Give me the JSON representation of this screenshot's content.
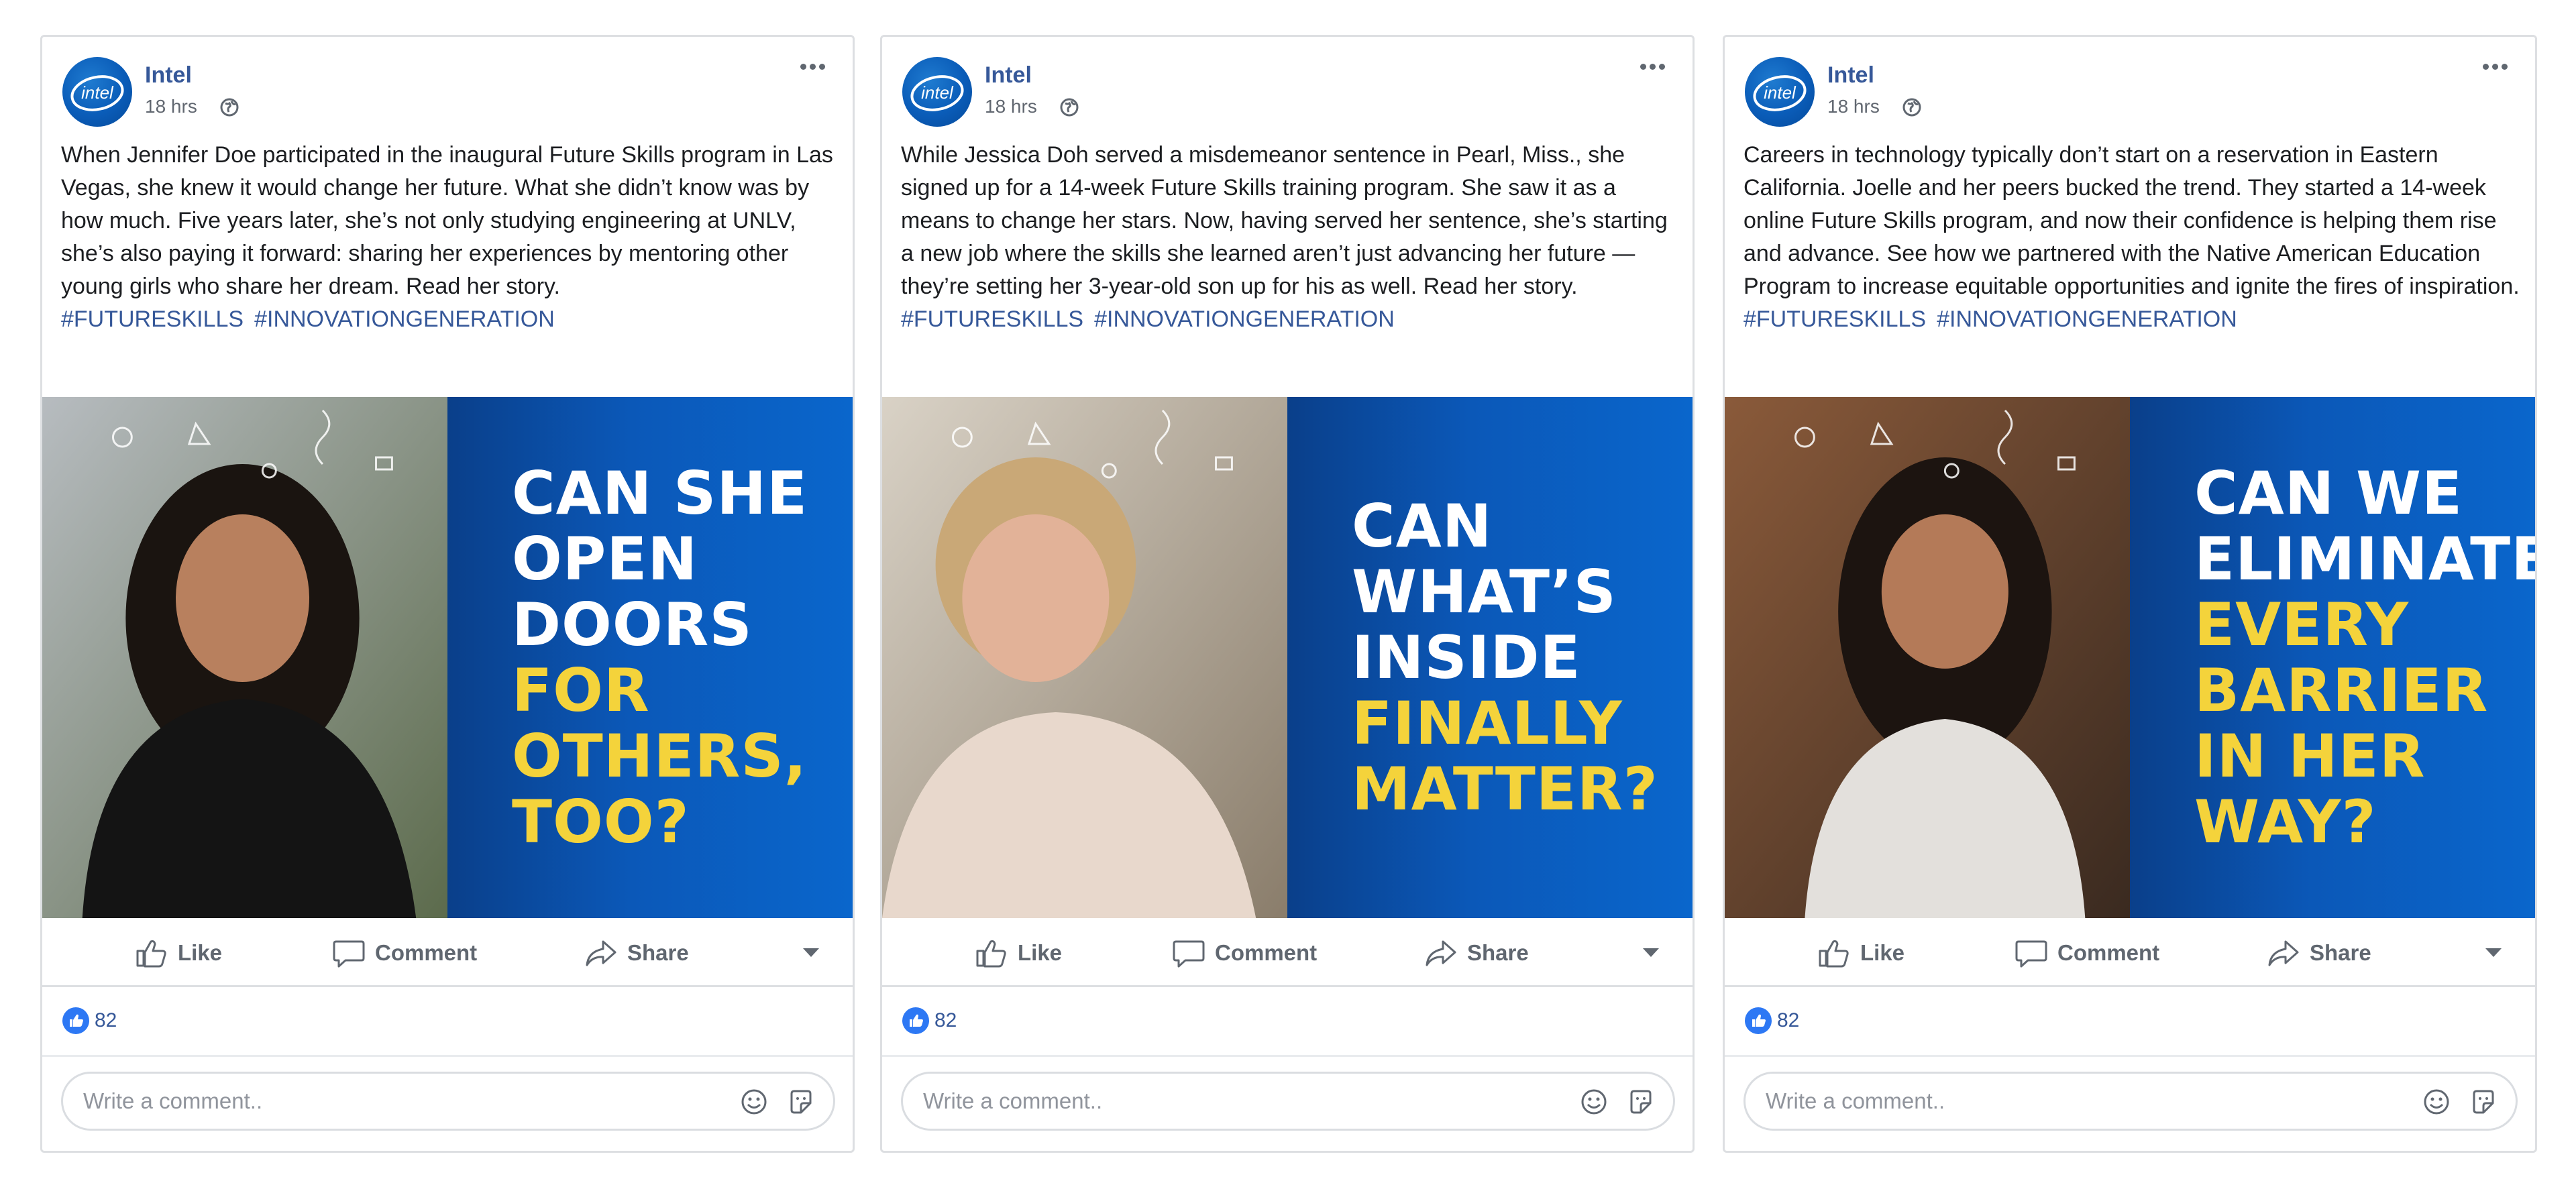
{
  "posts": [
    {
      "page_name": "Intel",
      "avatar_text": "intel",
      "timestamp": "18 hrs",
      "body": "When Jennifer Doe participated in the inaugural Future Skills program in Las Vegas, she knew it would change her future. What she didn’t know was by how much. Five years later, she’s not only studying engineering at UNLV, she’s also paying it forward: sharing her experiences by mentoring other young girls who share her dream. Read her story.",
      "hashtags": [
        "#FUTURESKILLS",
        "#INNOVATIONGENERATION"
      ],
      "headline": [
        {
          "text": "CAN SHE",
          "accent": false
        },
        {
          "text": "OPEN",
          "accent": false
        },
        {
          "text": "DOORS",
          "accent": false
        },
        {
          "text": "FOR",
          "accent": true
        },
        {
          "text": "OTHERS,",
          "accent": true
        },
        {
          "text": "TOO?",
          "accent": true
        }
      ],
      "actions": {
        "like": "Like",
        "comment": "Comment",
        "share": "Share"
      },
      "reaction_count": "82",
      "comment_placeholder": "Write a comment.."
    },
    {
      "page_name": "Intel",
      "avatar_text": "intel",
      "timestamp": "18 hrs",
      "body": "While Jessica Doh served a misdemeanor sentence in Pearl, Miss., she signed up for a 14-week Future Skills training program. She saw it as a means to change her stars. Now, having served her sentence, she’s starting a new job where the skills she learned aren’t just advancing her future — they’re setting her 3-year-old son up for his as well. Read her story.",
      "hashtags": [
        "#FUTURESKILLS",
        "#INNOVATIONGENERATION"
      ],
      "headline": [
        {
          "text": "CAN",
          "accent": false
        },
        {
          "text": "WHAT’S",
          "accent": false
        },
        {
          "text": "INSIDE",
          "accent": false
        },
        {
          "text": "FINALLY",
          "accent": true
        },
        {
          "text": "MATTER?",
          "accent": true
        }
      ],
      "actions": {
        "like": "Like",
        "comment": "Comment",
        "share": "Share"
      },
      "reaction_count": "82",
      "comment_placeholder": "Write a comment.."
    },
    {
      "page_name": "Intel",
      "avatar_text": "intel",
      "timestamp": "18 hrs",
      "body": "Careers in technology typically don’t start on a reservation in Eastern California. Joelle and her peers bucked the trend. They started a 14-week online Future Skills program, and now their confidence is helping them rise and advance. See how we partnered with the Native American Education Program to increase equitable opportunities and ignite the fires of inspiration.",
      "hashtags": [
        "#FUTURESKILLS",
        "#INNOVATIONGENERATION"
      ],
      "headline": [
        {
          "text": "CAN WE",
          "accent": false
        },
        {
          "text": "ELIMINATE",
          "accent": false
        },
        {
          "text": "EVERY",
          "accent": true
        },
        {
          "text": "BARRIER",
          "accent": true
        },
        {
          "text": "IN HER",
          "accent": true
        },
        {
          "text": "WAY?",
          "accent": true
        }
      ],
      "actions": {
        "like": "Like",
        "comment": "Comment",
        "share": "Share"
      },
      "reaction_count": "82",
      "comment_placeholder": "Write a comment.."
    }
  ],
  "colors": {
    "link": "#365899",
    "accent_yellow": "#f4d33b",
    "panel_blue": "#0b58b8",
    "like_blue": "#2d78f4"
  },
  "icons": [
    "globe-icon",
    "more-icon",
    "like-icon",
    "comment-icon",
    "share-icon",
    "caret-down-icon",
    "emoji-icon",
    "sticker-icon"
  ]
}
